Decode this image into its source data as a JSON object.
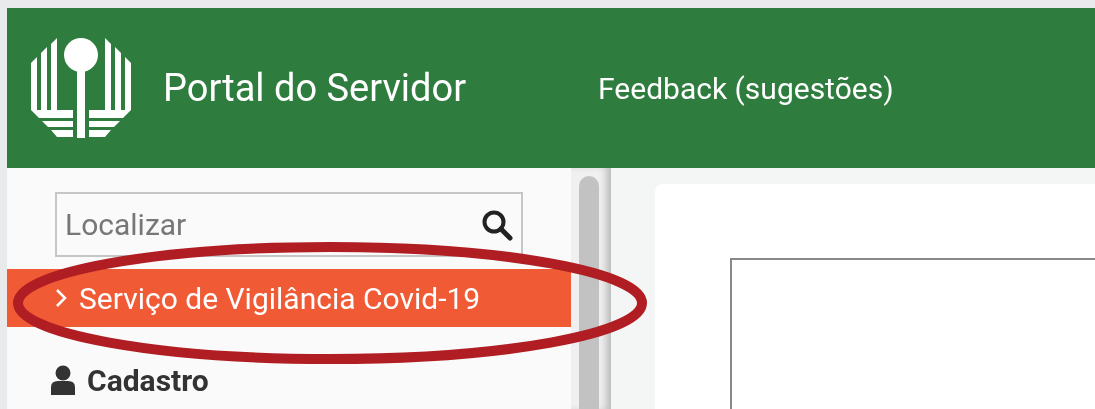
{
  "header": {
    "title": "Portal do Servidor",
    "links": [
      {
        "label": "Feedback (sugestões)"
      }
    ]
  },
  "sidebar": {
    "search": {
      "placeholder": "Localizar"
    },
    "items": [
      {
        "kind": "link",
        "label": "Serviço de Vigilância Covid-19",
        "selected": true
      },
      {
        "kind": "section",
        "label": "Cadastro",
        "selected": false
      }
    ]
  },
  "annotation": {
    "kind": "ellipse"
  }
}
